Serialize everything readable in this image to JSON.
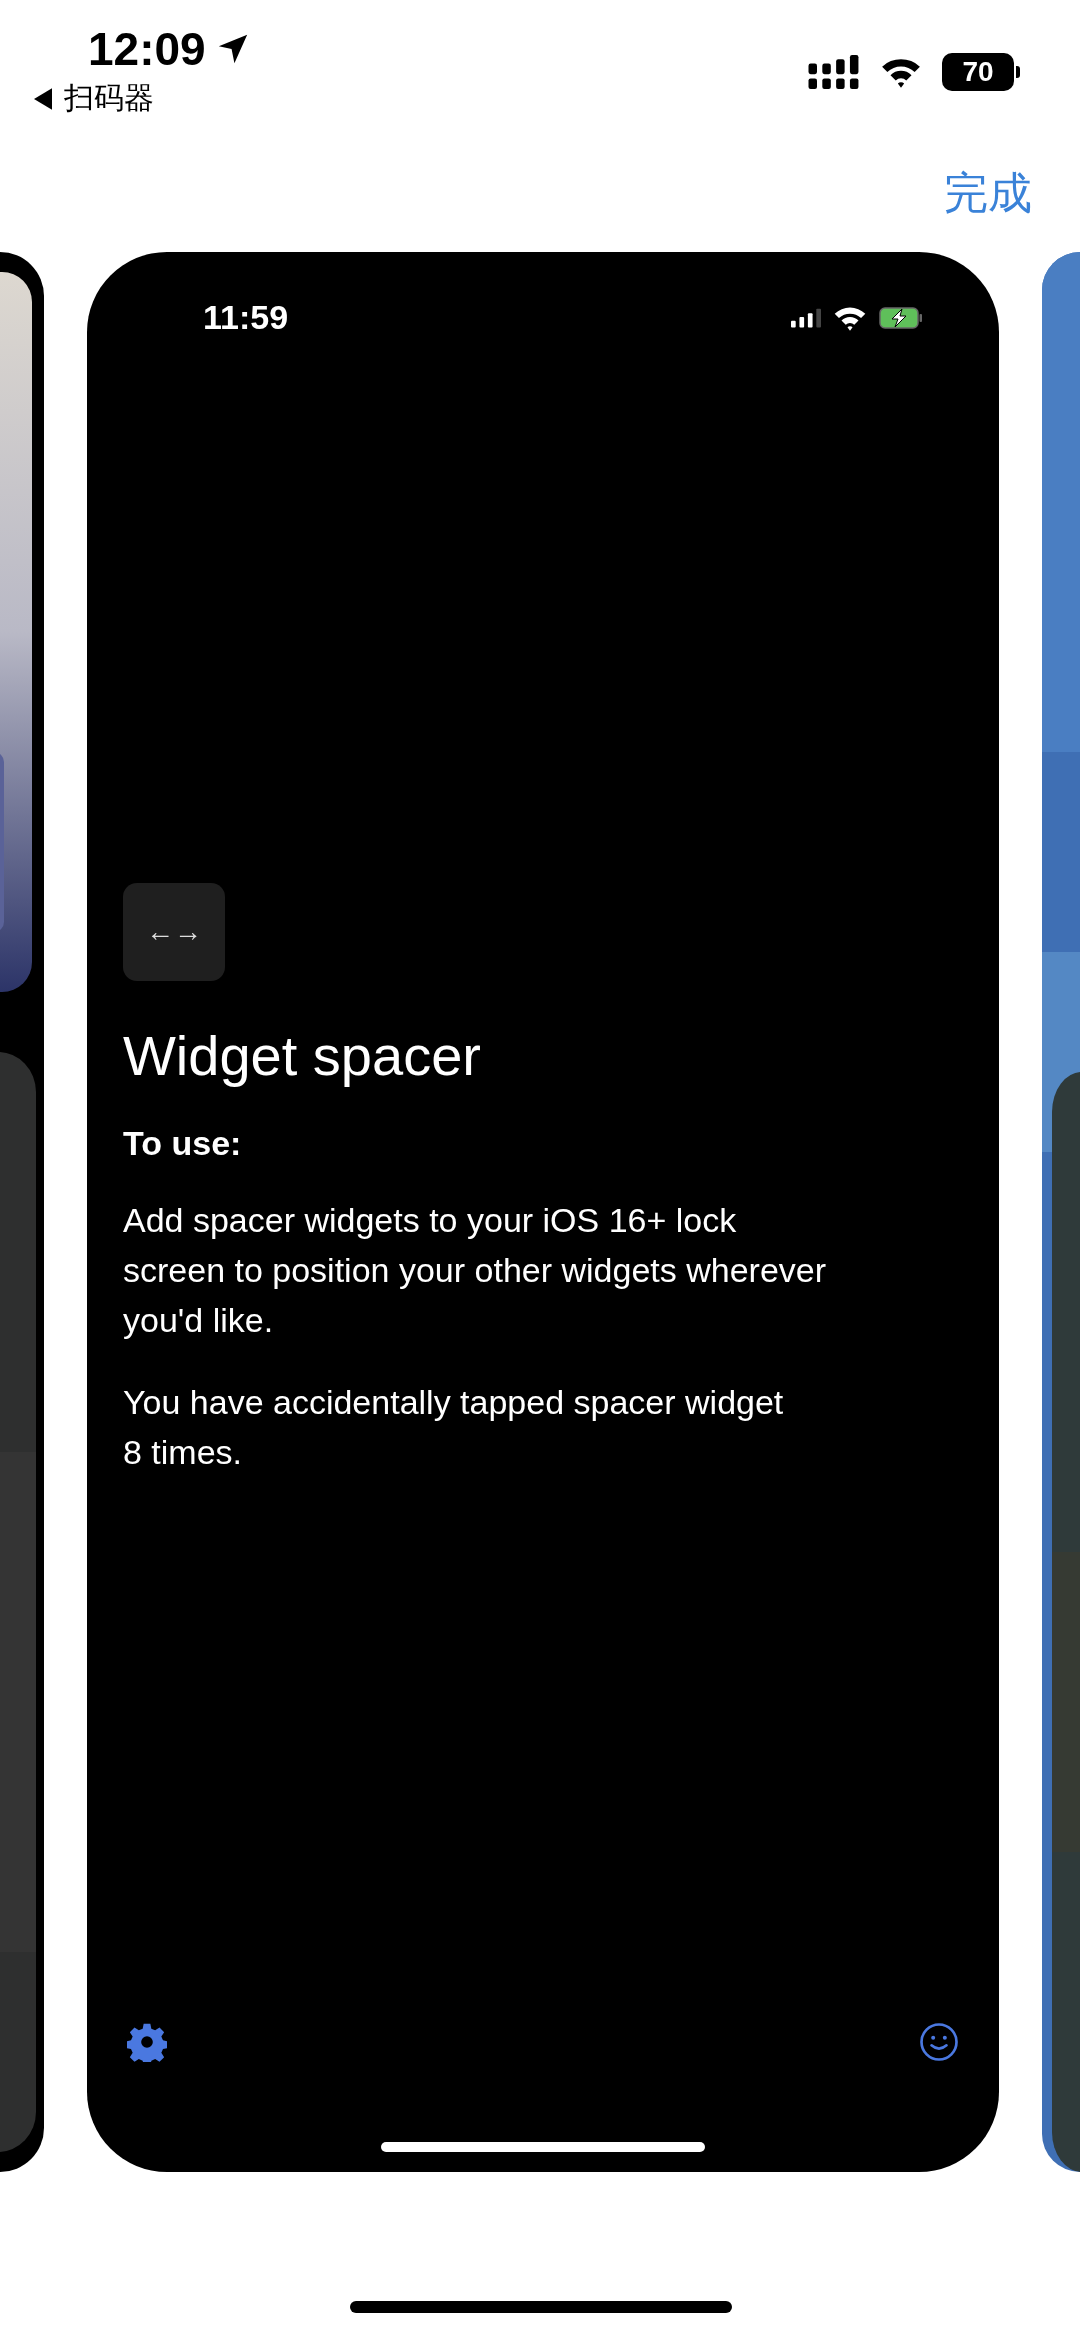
{
  "status_bar": {
    "time": "12:09",
    "back_label": "扫码器",
    "battery": "70"
  },
  "nav": {
    "done": "完成"
  },
  "preview": {
    "status_bar": {
      "time": "11:59"
    },
    "icon_label": "←→",
    "title": "Widget spacer",
    "subtitle": "To use:",
    "paragraphs": [
      "Add spacer widgets to your iOS 16+ lock\nscreen to position your other widgets wherever\nyou'd like.",
      "You have accidentally tapped spacer widget\n8 times."
    ]
  }
}
